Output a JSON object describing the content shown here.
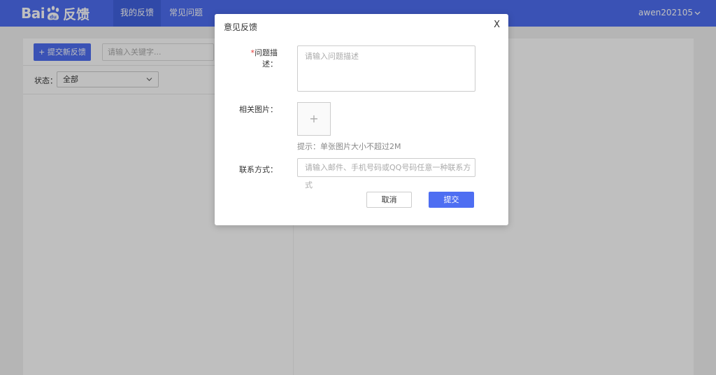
{
  "header": {
    "logo_left": "Bai",
    "logo_paw": "du",
    "logo_sub": "反馈",
    "tabs": [
      {
        "label": "我的反馈",
        "active": true
      },
      {
        "label": "常见问题",
        "active": false
      }
    ],
    "user": "awen202105"
  },
  "page": {
    "new_button": "+ 提交新反馈",
    "search_placeholder": "请输入关键字...",
    "status_label": "状态：",
    "status_value": "全部"
  },
  "modal": {
    "title": "意见反馈",
    "close": "X",
    "desc_required": "*",
    "desc_label": "问题描述：",
    "desc_placeholder": "请输入问题描述",
    "images_label": "相关图片：",
    "upload_plus": "+",
    "hint": "提示：单张图片大小不超过2M",
    "contact_label": "联系方式：",
    "contact_placeholder": "请输入邮件、手机号码或QQ号码任意一种联系方式",
    "cancel": "取消",
    "submit": "提交"
  },
  "colors": {
    "brand": "#4e6ef2",
    "required": "#e53935"
  }
}
